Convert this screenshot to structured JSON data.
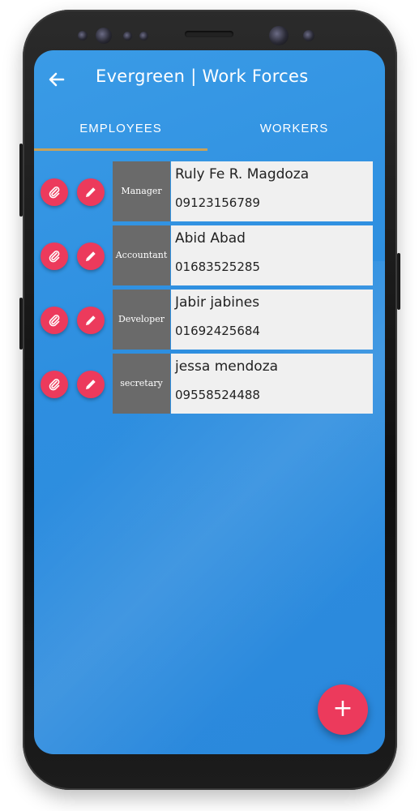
{
  "app": {
    "title": "Evergreen | Work Forces",
    "back_icon": "arrow-left-icon"
  },
  "tabs": [
    {
      "label": "EMPLOYEES",
      "active": true
    },
    {
      "label": "WORKERS",
      "active": false
    }
  ],
  "colors": {
    "primary": "#2e8fe0",
    "accent": "#ec3a5c",
    "tab_indicator": "#c8a25a",
    "role_bg": "#6a6a6a",
    "card_bg": "#f0f0f0"
  },
  "employees": [
    {
      "role": "Manager",
      "name": "Ruly Fe R. Magdoza",
      "phone": "09123156789",
      "attach_icon": "paperclip-icon",
      "edit_icon": "pencil-icon"
    },
    {
      "role": "Accountant",
      "name": "Abid Abad",
      "phone": "01683525285",
      "attach_icon": "paperclip-icon",
      "edit_icon": "pencil-icon"
    },
    {
      "role": "Developer",
      "name": "Jabir jabines",
      "phone": "01692425684",
      "attach_icon": "paperclip-icon",
      "edit_icon": "pencil-icon"
    },
    {
      "role": "secretary",
      "name": "jessa mendoza",
      "phone": "09558524488",
      "attach_icon": "paperclip-icon",
      "edit_icon": "pencil-icon"
    }
  ],
  "fab": {
    "label": "+",
    "icon": "plus-icon"
  }
}
